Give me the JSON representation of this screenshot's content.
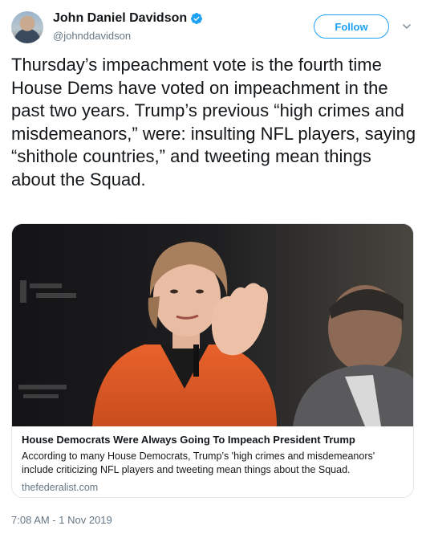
{
  "author": {
    "name": "John Daniel Davidson",
    "handle": "@johnddavidson",
    "verified": true
  },
  "follow_label": "Follow",
  "tweet": {
    "text": "Thursday’s impeachment vote is the fourth time House Dems have voted on impeachment in the past two years. Trump’s previous “high crimes and misdemeanors,” were: insulting NFL players, saying “shithole countries,” and tweeting mean things about the Squad.",
    "timestamp": "7:08 AM - 1 Nov 2019"
  },
  "card": {
    "title": "House Democrats Were Always Going To Impeach President Trump",
    "description": "According to many House Democrats, Trump’s 'high crimes and misdemeanors' include criticizing NFL players and tweeting mean things about the Squad.",
    "domain": "thefederalist.com"
  },
  "icons": {
    "verified": "verified-badge-icon",
    "caret": "chevron-down-icon"
  },
  "colors": {
    "accent": "#1da1f2",
    "secondary_text": "#657786",
    "border": "#e1e8ed"
  }
}
